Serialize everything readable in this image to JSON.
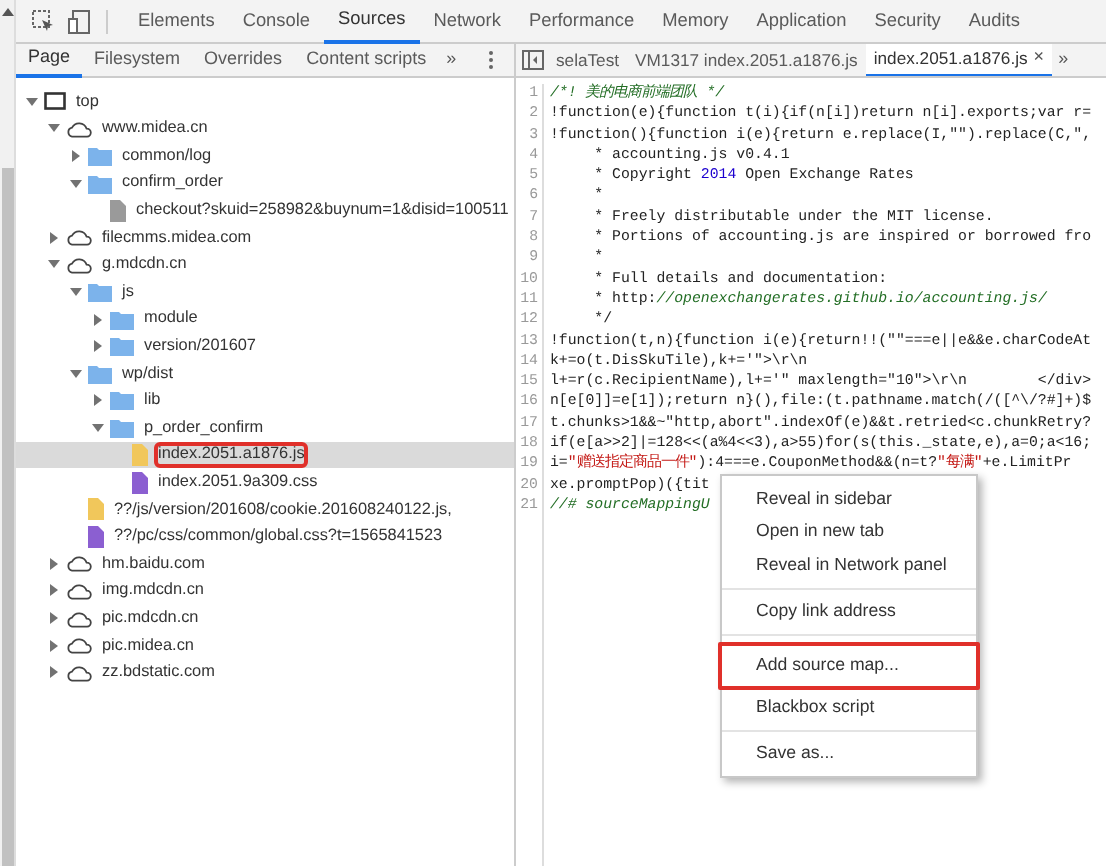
{
  "main_tabs": [
    {
      "label": "Elements",
      "selected": false
    },
    {
      "label": "Console",
      "selected": false
    },
    {
      "label": "Sources",
      "selected": true
    },
    {
      "label": "Network",
      "selected": false
    },
    {
      "label": "Performance",
      "selected": false
    },
    {
      "label": "Memory",
      "selected": false
    },
    {
      "label": "Application",
      "selected": false
    },
    {
      "label": "Security",
      "selected": false
    },
    {
      "label": "Audits",
      "selected": false
    }
  ],
  "sidebar": {
    "tabs": [
      {
        "label": "Page",
        "selected": true
      },
      {
        "label": "Filesystem",
        "selected": false
      },
      {
        "label": "Overrides",
        "selected": false
      },
      {
        "label": "Content scripts",
        "selected": false
      }
    ],
    "more": "»",
    "tree": [
      {
        "kind": "frame",
        "label": "top",
        "expanded": true,
        "selected": false,
        "children": [
          {
            "kind": "domain",
            "label": "www.midea.cn",
            "expanded": true,
            "selected": false,
            "children": [
              {
                "kind": "folder",
                "label": "common/log",
                "expanded": false,
                "selected": false
              },
              {
                "kind": "folder",
                "label": "confirm_order",
                "expanded": true,
                "selected": false,
                "children": [
                  {
                    "kind": "document",
                    "label": "checkout?skuid=258982&buynum=1&disid=100511",
                    "selected": false
                  }
                ]
              }
            ]
          },
          {
            "kind": "domain",
            "label": "filecmms.midea.com",
            "expanded": false,
            "selected": false
          },
          {
            "kind": "domain",
            "label": "g.mdcdn.cn",
            "expanded": true,
            "selected": false,
            "children": [
              {
                "kind": "folder",
                "label": "js",
                "expanded": true,
                "selected": false,
                "children": [
                  {
                    "kind": "folder",
                    "label": "module",
                    "expanded": false,
                    "selected": false
                  },
                  {
                    "kind": "folder",
                    "label": "version/201607",
                    "expanded": false,
                    "selected": false
                  }
                ]
              },
              {
                "kind": "folder",
                "label": "wp/dist",
                "expanded": true,
                "selected": false,
                "children": [
                  {
                    "kind": "folder",
                    "label": "lib",
                    "expanded": false,
                    "selected": false
                  },
                  {
                    "kind": "folder",
                    "label": "p_order_confirm",
                    "expanded": true,
                    "selected": false,
                    "children": [
                      {
                        "kind": "script",
                        "label": "index.2051.a1876.js",
                        "selected": true,
                        "annotated": true
                      },
                      {
                        "kind": "stylesheet",
                        "label": "index.2051.9a309.css",
                        "selected": false
                      }
                    ]
                  }
                ]
              },
              {
                "kind": "script",
                "label": "??/js/version/201608/cookie.201608240122.js,",
                "selected": false
              },
              {
                "kind": "stylesheet",
                "label": "??/pc/css/common/global.css?t=1565841523",
                "selected": false
              }
            ]
          },
          {
            "kind": "domain",
            "label": "hm.baidu.com",
            "expanded": false,
            "selected": false
          },
          {
            "kind": "domain",
            "label": "img.mdcdn.cn",
            "expanded": false,
            "selected": false
          },
          {
            "kind": "domain",
            "label": "pic.mdcdn.cn",
            "expanded": false,
            "selected": false
          },
          {
            "kind": "domain",
            "label": "pic.midea.cn",
            "expanded": false,
            "selected": false
          },
          {
            "kind": "domain",
            "label": "zz.bdstatic.com",
            "expanded": false,
            "selected": false
          }
        ]
      }
    ]
  },
  "editor": {
    "tabs": [
      {
        "label": "selaTest",
        "selected": false,
        "closable": false
      },
      {
        "label": "VM1317 index.2051.a1876.js",
        "selected": false,
        "closable": false
      },
      {
        "label": "index.2051.a1876.js",
        "selected": true,
        "closable": true
      }
    ],
    "close": "×",
    "more": "»",
    "lines": [
      {
        "number": "1",
        "segments": [
          {
            "kind": "comment",
            "text": "/*! 美的电商前端团队 */"
          }
        ]
      },
      {
        "number": "2",
        "segments": [
          {
            "kind": "code",
            "text": "!function(e){function t(i){if(n[i])return n[i].exports;var r="
          }
        ]
      },
      {
        "number": "3",
        "segments": [
          {
            "kind": "code",
            "text": "!function(){function i(e){return e.replace(I,\"\").replace(C,\","
          }
        ]
      },
      {
        "number": "4",
        "segments": [
          {
            "kind": "code",
            "text": "     * accounting.js v0.4.1"
          }
        ]
      },
      {
        "number": "5",
        "segments": [
          {
            "kind": "code",
            "text": "     * Copyright "
          },
          {
            "kind": "number",
            "text": "2014"
          },
          {
            "kind": "code",
            "text": " Open Exchange Rates"
          }
        ]
      },
      {
        "number": "6",
        "segments": [
          {
            "kind": "code",
            "text": "     *"
          }
        ]
      },
      {
        "number": "7",
        "segments": [
          {
            "kind": "code",
            "text": "     * Freely distributable under the MIT license."
          }
        ]
      },
      {
        "number": "8",
        "segments": [
          {
            "kind": "code",
            "text": "     * Portions of accounting.js are inspired or borrowed fro"
          }
        ]
      },
      {
        "number": "9",
        "segments": [
          {
            "kind": "code",
            "text": "     *"
          }
        ]
      },
      {
        "number": "10",
        "segments": [
          {
            "kind": "code",
            "text": "     * Full details and documentation:"
          }
        ]
      },
      {
        "number": "11",
        "segments": [
          {
            "kind": "code",
            "text": "     * http:"
          },
          {
            "kind": "comment",
            "text": "//openexchangerates.github.io/accounting.js/"
          }
        ]
      },
      {
        "number": "12",
        "segments": [
          {
            "kind": "code",
            "text": "     */"
          }
        ]
      },
      {
        "number": "13",
        "segments": [
          {
            "kind": "code",
            "text": "!function(t,n){function i(e){return!!(\"\"===e||e&&e.charCodeAt"
          }
        ]
      },
      {
        "number": "14",
        "segments": [
          {
            "kind": "code",
            "text": "k+=o(t.DisSkuTile),k+='\">\\r\\n"
          }
        ]
      },
      {
        "number": "15",
        "segments": [
          {
            "kind": "code",
            "text": "l+=r(c.RecipientName),l+='\" maxlength=\"10\">\\r\\n        </div>"
          }
        ]
      },
      {
        "number": "16",
        "segments": [
          {
            "kind": "code",
            "text": "n[e[0]]=e[1]);return n}(),file:(t.pathname.match(/([^\\/?#]+)$"
          }
        ]
      },
      {
        "number": "17",
        "segments": [
          {
            "kind": "code",
            "text": "t.chunks>1&&~\"http,abort\".indexOf(e)&&t.retried<c.chunkRetry?"
          }
        ]
      },
      {
        "number": "18",
        "segments": [
          {
            "kind": "code",
            "text": "if(e[a>>2]|=128<<(a%4<<3),a>55)for(s(this._state,e),a=0;a<16;"
          }
        ]
      },
      {
        "number": "19",
        "segments": [
          {
            "kind": "code",
            "text": "i="
          },
          {
            "kind": "string",
            "text": "\"赠送指定商品一件\""
          },
          {
            "kind": "code",
            "text": "):4===e.CouponMethod&&(n=t?"
          },
          {
            "kind": "string",
            "text": "\"每满\""
          },
          {
            "kind": "code",
            "text": "+e.LimitPr"
          }
        ]
      },
      {
        "number": "20",
        "segments": [
          {
            "kind": "code",
            "text": "xe.promptPop)({tit"
          }
        ]
      },
      {
        "number": "21",
        "segments": [
          {
            "kind": "comment",
            "text": "//# sourceMappingU"
          }
        ]
      }
    ]
  },
  "context_menu": [
    {
      "kind": "item",
      "label": "Reveal in sidebar",
      "annotated": false
    },
    {
      "kind": "item",
      "label": "Open in new tab",
      "annotated": false
    },
    {
      "kind": "item",
      "label": "Reveal in Network panel",
      "annotated": false
    },
    {
      "kind": "separator"
    },
    {
      "kind": "item",
      "label": "Copy link address",
      "annotated": false
    },
    {
      "kind": "separator"
    },
    {
      "kind": "item",
      "label": "Add source map...",
      "annotated": true
    },
    {
      "kind": "item",
      "label": "Blackbox script",
      "annotated": false
    },
    {
      "kind": "separator"
    },
    {
      "kind": "item",
      "label": "Save as...",
      "annotated": false
    }
  ]
}
